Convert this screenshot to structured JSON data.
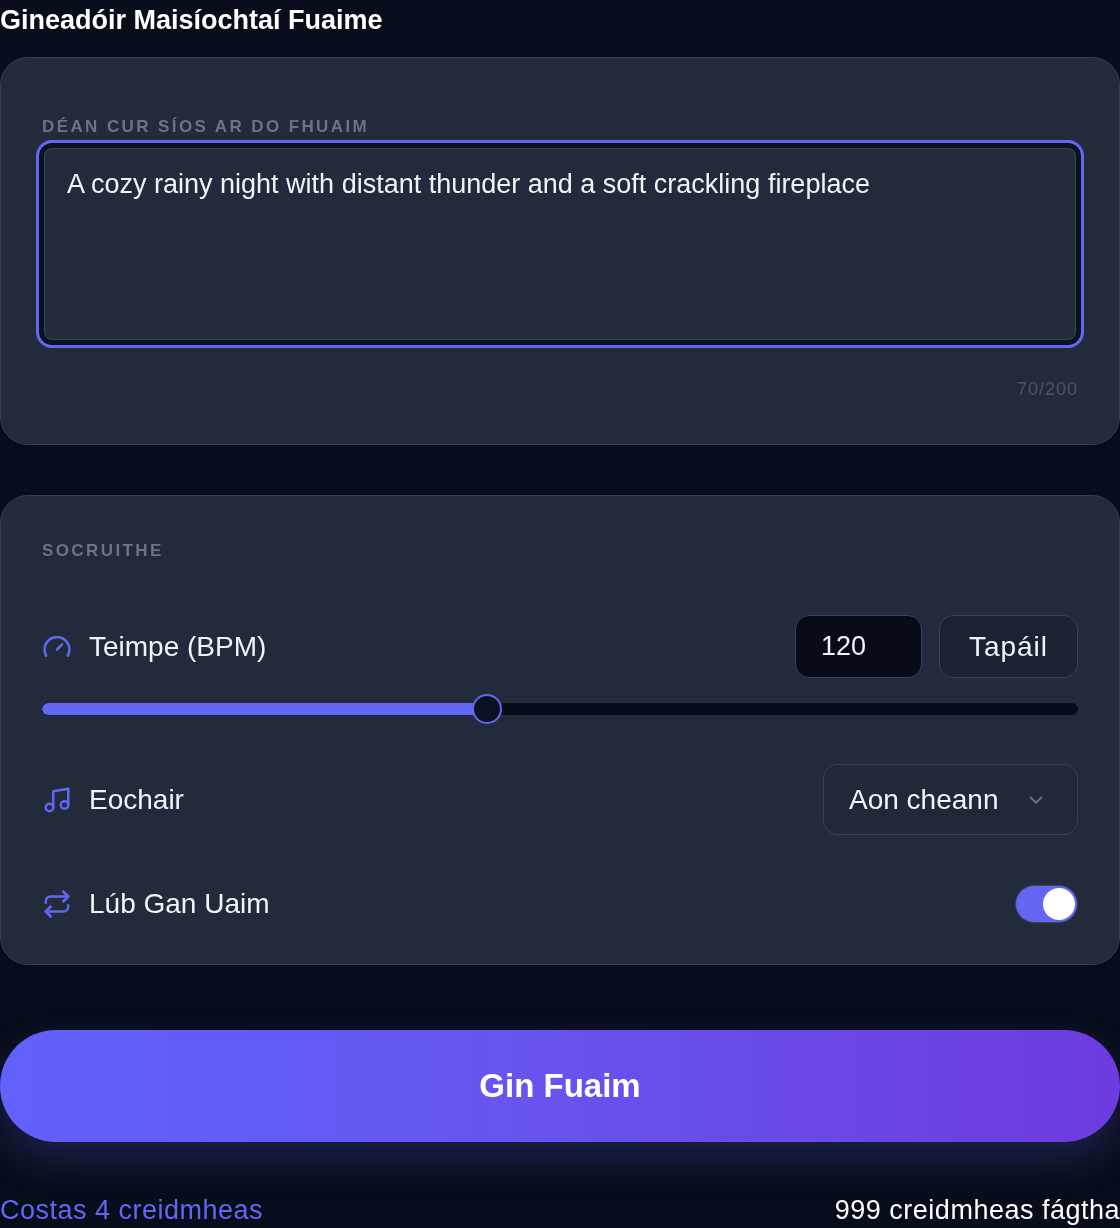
{
  "title": "Gineadóir Maisíochtaí Fuaime",
  "description": {
    "label": "DÉAN CUR SÍOS AR DO FHUAIM",
    "value": "A cozy rainy night with distant thunder and a soft crackling fireplace",
    "counter": "70/200",
    "focused": true
  },
  "settings": {
    "heading": "SOCRUITHE",
    "tempo": {
      "label": "Teimpe (BPM)",
      "value": "120",
      "tap_button": "Tapáil",
      "level": 0.43
    },
    "key": {
      "label": "Eochair",
      "value": "Aon cheann"
    },
    "loop": {
      "label": "Lúb Gan Uaim",
      "on": true
    }
  },
  "generate_button": "Gin Fuaim",
  "footer": {
    "cost": "Costas 4 creidmheas",
    "remaining": "999 creidmheas fágtha"
  }
}
